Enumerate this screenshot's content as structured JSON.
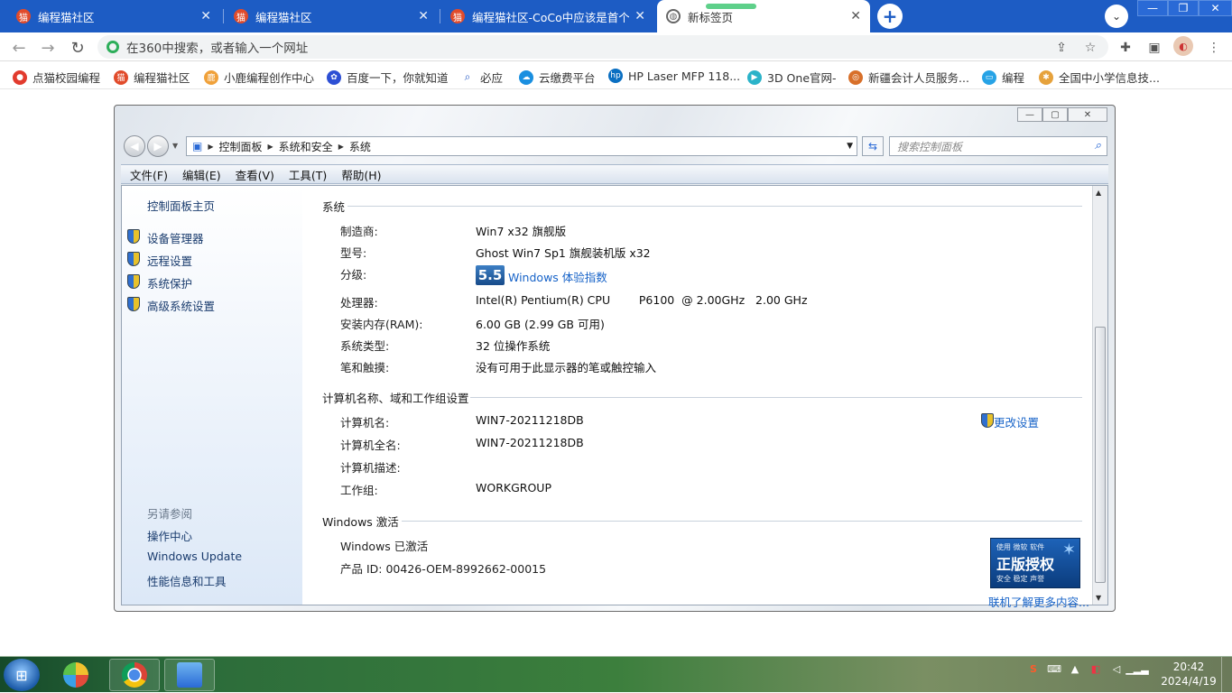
{
  "browser": {
    "tabs": [
      {
        "title": "编程猫社区",
        "active": false
      },
      {
        "title": "编程猫社区",
        "active": false
      },
      {
        "title": "编程猫社区-CoCo中应该是首个支",
        "active": false
      },
      {
        "title": "新标签页",
        "active": true
      }
    ],
    "omnibox_placeholder": "在360中搜索，或者输入一个网址",
    "bookmarks": [
      "点猫校园编程",
      "编程猫社区",
      "小鹿编程创作中心",
      "百度一下，你就知道",
      "必应",
      "云缴费平台",
      "HP Laser MFP 118...",
      "3D One官网-",
      "新疆会计人员服务...",
      "编程",
      "全国中小学信息技..."
    ]
  },
  "explorer": {
    "breadcrumb": [
      "控制面板",
      "系统和安全",
      "系统"
    ],
    "search_placeholder": "搜索控制面板",
    "menu": [
      "文件(F)",
      "编辑(E)",
      "查看(V)",
      "工具(T)",
      "帮助(H)"
    ],
    "left_pane": {
      "home": "控制面板主页",
      "tasks": [
        "设备管理器",
        "远程设置",
        "系统保护",
        "高级系统设置"
      ],
      "see_also_title": "另请参阅",
      "see_also": [
        "操作中心",
        "Windows Update",
        "性能信息和工具"
      ]
    }
  },
  "system": {
    "section_title": "系统",
    "rows": [
      {
        "label": "制造商:",
        "value": "Win7 x32 旗舰版"
      },
      {
        "label": "型号:",
        "value": "Ghost Win7 Sp1 旗舰装机版 x32"
      },
      {
        "label": "分级:",
        "value": "Windows 体验指数"
      },
      {
        "label": "处理器:",
        "value": "Intel(R) Pentium(R) CPU        P6100  @ 2.00GHz   2.00 GHz"
      },
      {
        "label": "安装内存(RAM):",
        "value": "6.00 GB (2.99 GB 可用)"
      },
      {
        "label": "系统类型:",
        "value": "32 位操作系统"
      },
      {
        "label": "笔和触摸:",
        "value": "没有可用于此显示器的笔或触控输入"
      }
    ],
    "rating_score": "5.5"
  },
  "computer": {
    "section_title": "计算机名称、域和工作组设置",
    "change_settings": "更改设置",
    "rows": [
      {
        "label": "计算机名:",
        "value": "WIN7-20211218DB"
      },
      {
        "label": "计算机全名:",
        "value": "WIN7-20211218DB"
      },
      {
        "label": "计算机描述:",
        "value": ""
      },
      {
        "label": "工作组:",
        "value": "WORKGROUP"
      }
    ]
  },
  "activation": {
    "section_title": "Windows 激活",
    "status": "Windows 已激活",
    "product_id": "产品 ID: 00426-OEM-8992662-00015",
    "badge_line1": "使用 微软 软件",
    "badge_line2": "正版授权",
    "badge_line3": "安全 稳定 声誉",
    "learn_more": "联机了解更多内容..."
  },
  "taskbar": {
    "time": "20:42",
    "date": "2024/4/19"
  }
}
